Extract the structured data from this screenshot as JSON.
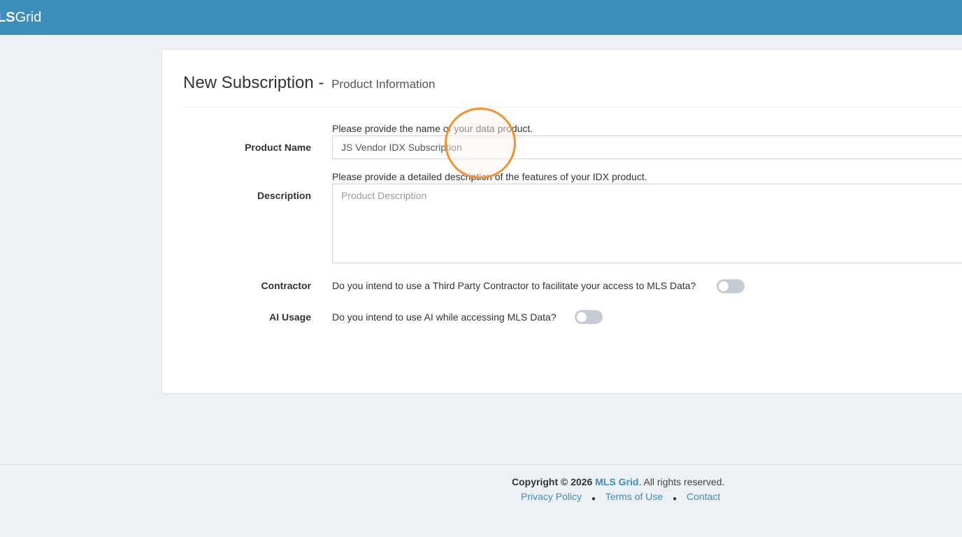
{
  "header": {
    "logo_bold": "LS",
    "logo_thin": "Grid",
    "bg_color": "#3c8dbc"
  },
  "form": {
    "title": "New Subscription -",
    "subtitle": "Product Information",
    "product_name": {
      "label": "Product Name",
      "help": "Please provide the name of your data product.",
      "value": "JS Vendor IDX Subscription"
    },
    "description": {
      "label": "Description",
      "help": "Please provide a detailed description of the features of your IDX product.",
      "placeholder": "Product Description",
      "value": ""
    },
    "contractor": {
      "label": "Contractor",
      "question": "Do you intend to use a Third Party Contractor to facilitate your access to MLS Data?",
      "enabled": false
    },
    "ai_usage": {
      "label": "AI Usage",
      "question": "Do you intend to use AI while accessing MLS Data?",
      "enabled": false
    }
  },
  "footer": {
    "copyright_prefix": "Copyright © 2026",
    "brand": "MLS Grid",
    "copyright_suffix": ". All rights reserved.",
    "links": [
      "Privacy Policy",
      "Terms of Use",
      "Contact"
    ],
    "link_color": "#3c8dbc"
  }
}
